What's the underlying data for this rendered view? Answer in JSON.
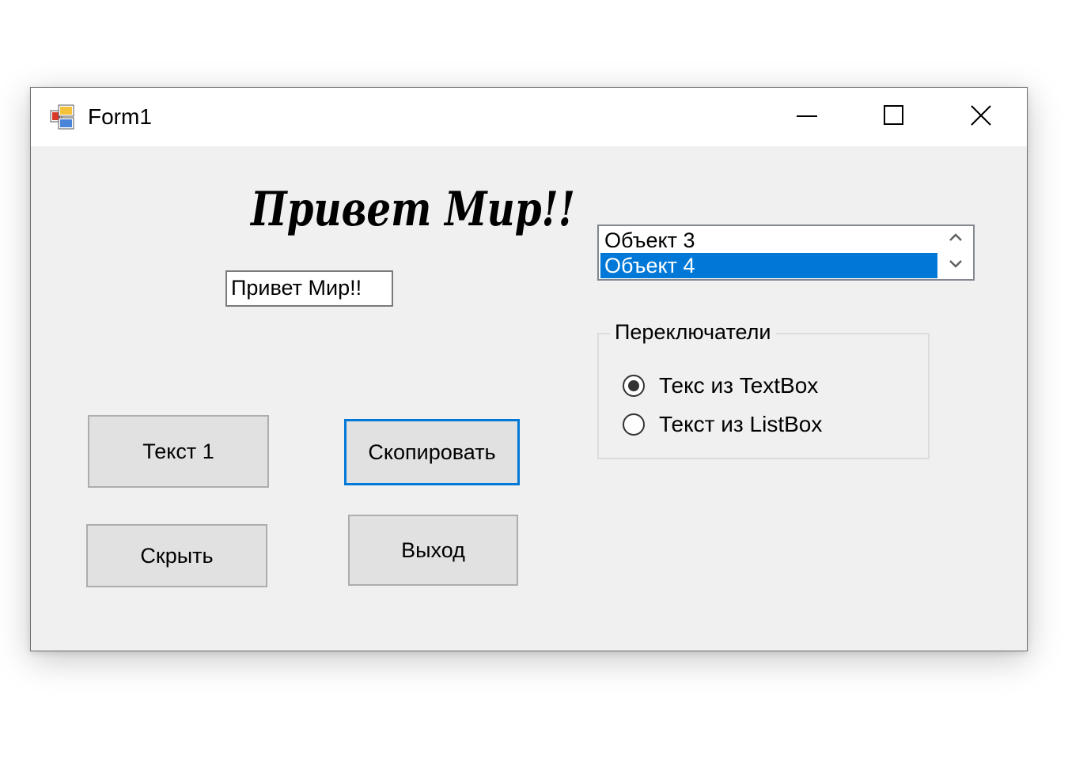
{
  "window": {
    "title": "Form1",
    "controls": {
      "minimize_icon": "minimize-icon",
      "maximize_icon": "maximize-icon",
      "close_icon": "close-icon"
    }
  },
  "greeting_label": {
    "text": "Привет Мир!!"
  },
  "textbox": {
    "value": "Привет Мир!!"
  },
  "listbox": {
    "items": [
      {
        "label": "Объект 3",
        "selected": false
      },
      {
        "label": "Объект 4",
        "selected": true
      }
    ],
    "selection_color": "#0078d7"
  },
  "groupbox": {
    "label": "Переключатели",
    "options": [
      {
        "label": "Текс из TextBox",
        "checked": true
      },
      {
        "label": "Текст из ListBox",
        "checked": false
      }
    ]
  },
  "buttons": {
    "text1": "Текст 1",
    "copy": "Скопировать",
    "hide": "Скрыть",
    "exit": "Выход"
  },
  "colors": {
    "accent": "#0078d7",
    "form_background": "#f0f0f0"
  }
}
